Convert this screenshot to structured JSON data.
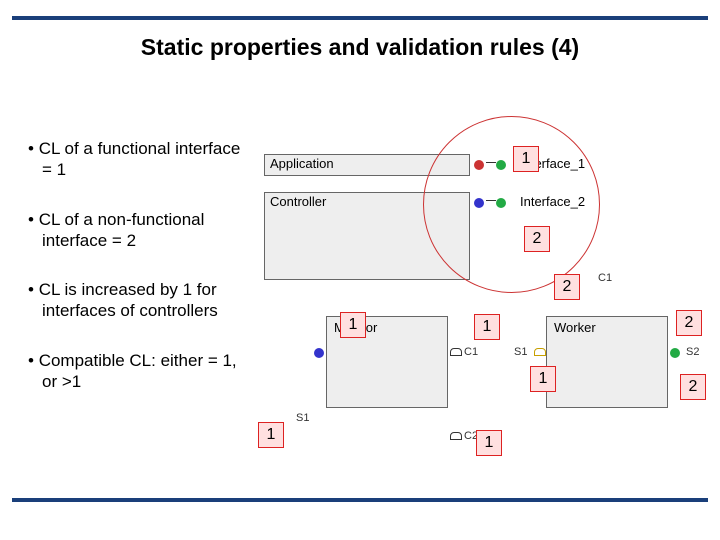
{
  "title": "Static properties and validation rules (4)",
  "bullets": {
    "b1": "CL of a functional interface = 1",
    "b2": "CL of a non-functional interface = 2",
    "b3": "CL is increased by 1 for interfaces of controllers",
    "b4": "Compatible CL: either = 1, or >1"
  },
  "diagram": {
    "application": "Application",
    "controller": "Controller",
    "monitor": "Monitor",
    "worker": "Worker",
    "iface1": "Interface_1",
    "iface2": "Interface_2",
    "c1a": "C1",
    "c1b": "C1",
    "c2": "C2",
    "s1": "S1",
    "s1b": "S1",
    "s2": "S2"
  },
  "numbers": {
    "n1": "1",
    "n2": "2",
    "n3": "2",
    "n4": "1",
    "n5": "1",
    "n6": "2",
    "n7": "1",
    "n8": "2",
    "n9": "1",
    "n10": "1"
  }
}
